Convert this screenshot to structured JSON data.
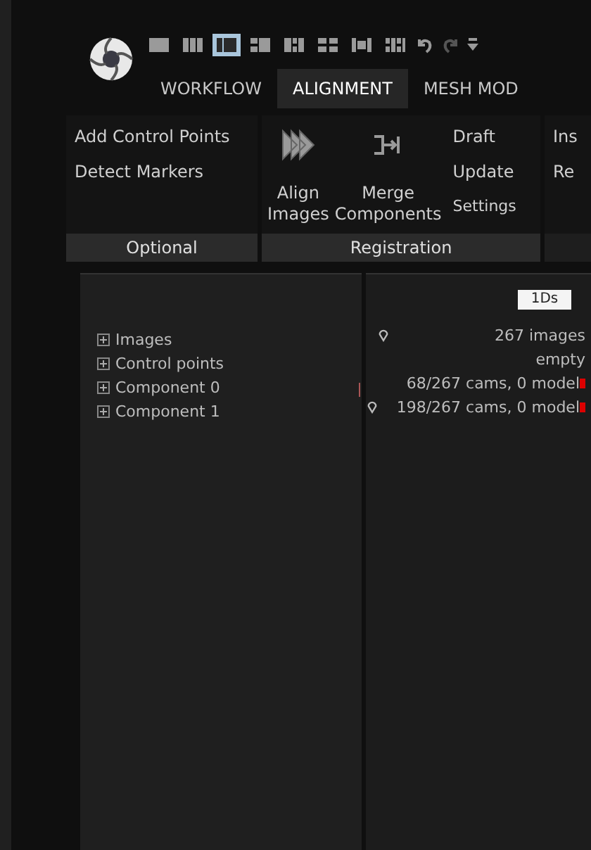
{
  "toolbar": [
    {
      "kind": "layout",
      "selected": false
    },
    {
      "kind": "layout",
      "selected": false
    },
    {
      "kind": "layout",
      "selected": true
    },
    {
      "kind": "layout",
      "selected": false
    },
    {
      "kind": "layout",
      "selected": false
    },
    {
      "kind": "layout",
      "selected": false
    },
    {
      "kind": "layout",
      "selected": false
    },
    {
      "kind": "layout",
      "selected": false
    },
    {
      "kind": "undo"
    },
    {
      "kind": "redo"
    },
    {
      "kind": "menu"
    }
  ],
  "tabs": [
    {
      "label": "WORKFLOW",
      "selected": false
    },
    {
      "label": "ALIGNMENT",
      "selected": true
    },
    {
      "label": "MESH MOD",
      "selected": false
    }
  ],
  "ribbon": {
    "optional": {
      "items": [
        "Add Control Points",
        "Detect Markers"
      ],
      "label": "Optional"
    },
    "registration": {
      "align": "Align\nImages",
      "merge": "Merge\nComponents",
      "items": [
        "Draft",
        "Update",
        "Settings"
      ],
      "label": "Registration"
    },
    "next": {
      "items": [
        "Ins",
        "Re"
      ]
    }
  },
  "tree": [
    {
      "label": "Images",
      "expanded": false
    },
    {
      "label": "Control points",
      "expanded": false
    },
    {
      "label": "Component 0",
      "expanded": false
    },
    {
      "label": "Component 1",
      "expanded": false
    }
  ],
  "details": {
    "header": "1Ds",
    "rows": [
      {
        "text": "267 images",
        "pin": true,
        "flag": false
      },
      {
        "text": "empty",
        "pin": false,
        "flag": false
      },
      {
        "text": "68/267 cams, 0 model",
        "pin": false,
        "flag": true
      },
      {
        "text": "198/267 cams, 0 model",
        "pin": true,
        "flag": true
      }
    ]
  }
}
